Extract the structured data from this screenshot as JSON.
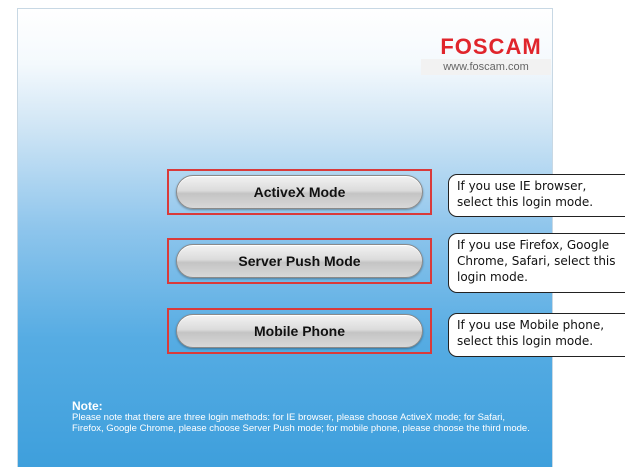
{
  "header": {
    "logo_text": "FOSCAM",
    "website": "www.foscam.com"
  },
  "modes": [
    {
      "label": "ActiveX Mode",
      "tip": "If you use IE browser,\nselect this login mode."
    },
    {
      "label": "Server Push Mode",
      "tip": "If you use Firefox, Google\nChrome, Safari, select this\nlogin mode."
    },
    {
      "label": "Mobile Phone",
      "tip": "If you use Mobile phone,\nselect this login mode."
    }
  ],
  "note": {
    "title": "Note:",
    "body": "Please note that there are three login methods: for IE browser, please choose ActiveX mode; for Safari, Firefox, Google Chrome, please choose Server Push mode; for mobile phone, please choose the third mode."
  },
  "colors": {
    "logo_red": "#e0252c",
    "highlight_red": "#d93a3a",
    "panel_blue": "#3e9fdc"
  }
}
